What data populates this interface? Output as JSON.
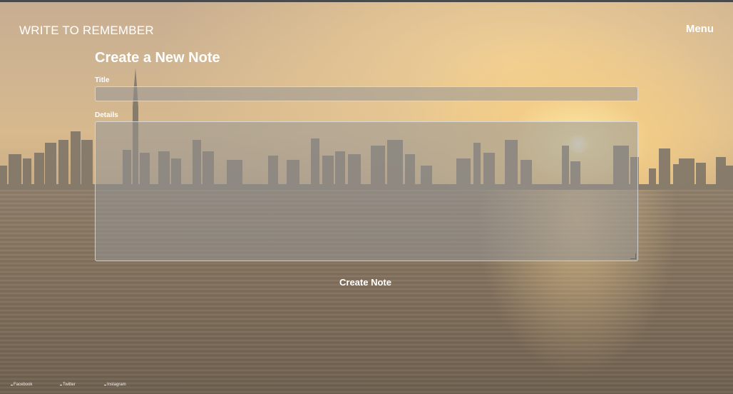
{
  "header": {
    "brand": "WRITE TO REMEMBER",
    "menu_label": "Menu"
  },
  "form": {
    "heading": "Create a New Note",
    "title_label": "Title",
    "title_value": "",
    "details_label": "Details",
    "details_value": "",
    "submit_label": "Create Note"
  },
  "footer": {
    "links": [
      {
        "label": "Facebook",
        "icon": "facebook-icon"
      },
      {
        "label": "Twitter",
        "icon": "twitter-icon"
      },
      {
        "label": "Instagram",
        "icon": "instagram-icon"
      }
    ]
  },
  "colors": {
    "text": "#ffffff",
    "field_bg": "#969696",
    "field_border": "#e6e6e6"
  }
}
